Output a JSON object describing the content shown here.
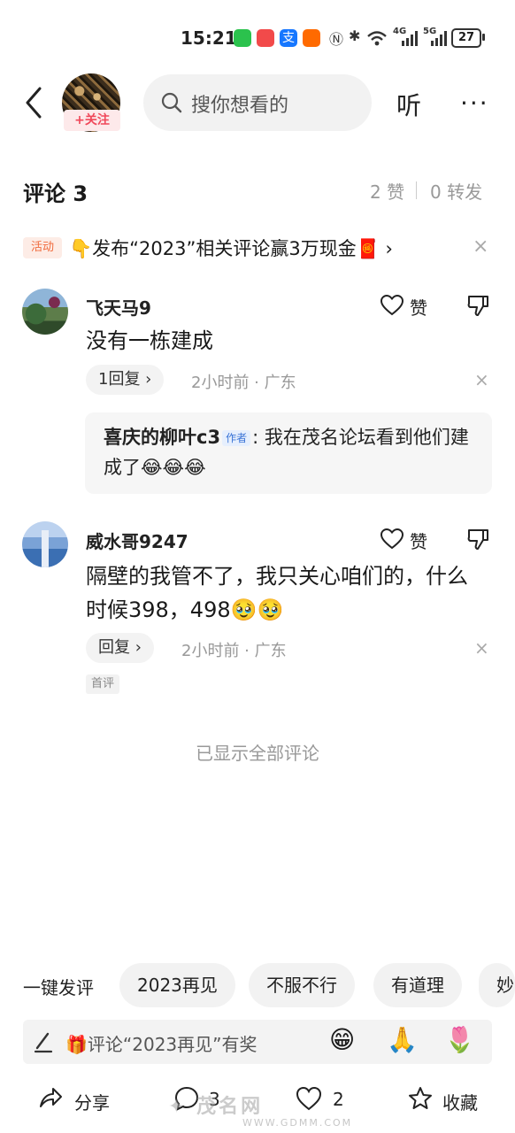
{
  "status_bar": {
    "time": "15:21",
    "network_1": "4G",
    "network_2": "5G",
    "battery": "27",
    "app_icons": [
      "wechat-icon",
      "kuaishou-icon",
      "alipay-icon",
      "taobao-icon"
    ]
  },
  "header": {
    "follow_label": "+关注",
    "search_placeholder": "搜你想看的",
    "listen_label": "听",
    "more_label": "···"
  },
  "comments_header": {
    "title": "评论 3",
    "likes": "2 赞",
    "shares": "0 转发"
  },
  "activity": {
    "tag": "活动",
    "text": "👇发布“2023”相关评论赢3万现金🧧 ›",
    "close": "×"
  },
  "comments": [
    {
      "username": "飞天马9",
      "text": "没有一栋建成",
      "like_label": "赞",
      "reply_label": "1回复 ›",
      "meta": "2小时前 · 广东",
      "reply": {
        "username": "喜庆的柳叶c3",
        "author_tag": "作者",
        "text": ": 我在茂名论坛看到他们建成了😂😂😂"
      }
    },
    {
      "username": "威水哥9247",
      "text": "隔壁的我管不了，我只关心咱们的，什么时候398，498🥹🥹",
      "like_label": "赞",
      "reply_label": "回复 ›",
      "meta": "2小时前 · 广东",
      "tag": "首评"
    }
  ],
  "shown_all": "已显示全部评论",
  "quick_reply": {
    "label": "一键发评",
    "chips": [
      "2023再见",
      "不服不行",
      "有道理",
      "妙"
    ]
  },
  "input": {
    "placeholder": "🎁评论“2023再见”有奖",
    "emojis": [
      "😁",
      "🙏",
      "🌷"
    ]
  },
  "bottom_bar": {
    "share": "分享",
    "comments_count": "3",
    "likes_count": "2",
    "collect": "收藏"
  },
  "watermark": {
    "text": "茂名网",
    "url": "WWW.GDMM.COM"
  }
}
